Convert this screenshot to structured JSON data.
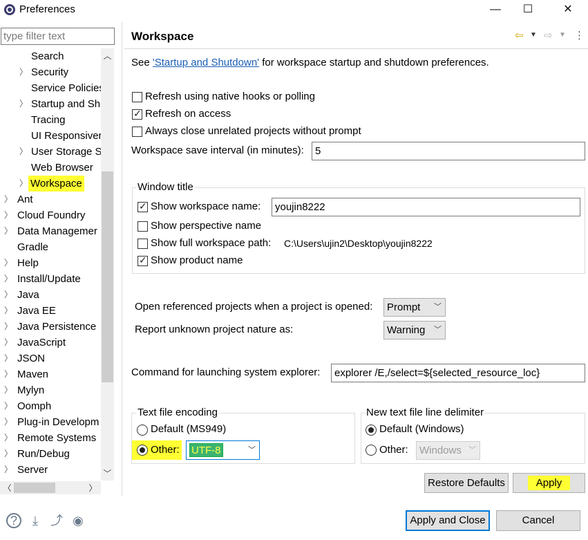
{
  "window": {
    "title": "Preferences",
    "minimize": "—",
    "maximize": "☐",
    "close": "✕"
  },
  "filter": {
    "placeholder": "type filter text"
  },
  "tree": {
    "children_under_parent": [
      "Search",
      "Security",
      "Service Policies",
      "Startup and Sh",
      "Tracing",
      "UI Responsiver",
      "User Storage S",
      "Web Browser",
      "Workspace"
    ],
    "top_level": [
      "Ant",
      "Cloud Foundry",
      "Data Managemer",
      "Gradle",
      "Help",
      "Install/Update",
      "Java",
      "Java EE",
      "Java Persistence",
      "JavaScript",
      "JSON",
      "Maven",
      "Mylyn",
      "Oomph",
      "Plug-in Developm",
      "Remote Systems",
      "Run/Debug",
      "Server"
    ]
  },
  "page": {
    "title": "Workspace",
    "desc_prefix": "See ",
    "desc_link": "'Startup and Shutdown'",
    "desc_suffix": " for workspace startup and shutdown preferences.",
    "opt_refresh_native": "Refresh using native hooks or polling",
    "opt_refresh_access": "Refresh on access",
    "opt_always_close": "Always close unrelated projects without prompt",
    "save_interval_label": "Workspace save interval (in minutes):",
    "save_interval_value": "5",
    "window_title_group": "Window title",
    "show_ws_name": "Show workspace name:",
    "ws_name_value": "youjin8222",
    "show_perspective": "Show perspective name",
    "show_full_path": "Show full workspace path:",
    "full_path_value": "C:\\Users\\ujin2\\Desktop\\youjin8222",
    "show_product": "Show product name",
    "open_ref_label": "Open referenced projects when a project is opened:",
    "open_ref_value": "Prompt",
    "report_label": "Report unknown project nature as:",
    "report_value": "Warning",
    "cmd_label": "Command for launching system explorer:",
    "cmd_value": "explorer /E,/select=${selected_resource_loc}",
    "encoding_group": "Text file encoding",
    "enc_default": "Default (MS949)",
    "enc_other": "Other:",
    "enc_other_value": "UTF-8",
    "delim_group": "New text file line delimiter",
    "delim_default": "Default (Windows)",
    "delim_other": "Other:",
    "delim_other_value": "Windows",
    "restore_defaults": "Restore Defaults",
    "apply": "Apply"
  },
  "footer": {
    "apply_close": "Apply and Close",
    "cancel": "Cancel"
  },
  "colors": {
    "highlight": "#ffff33",
    "accent": "#0078d7",
    "link": "#1a5fb4"
  }
}
